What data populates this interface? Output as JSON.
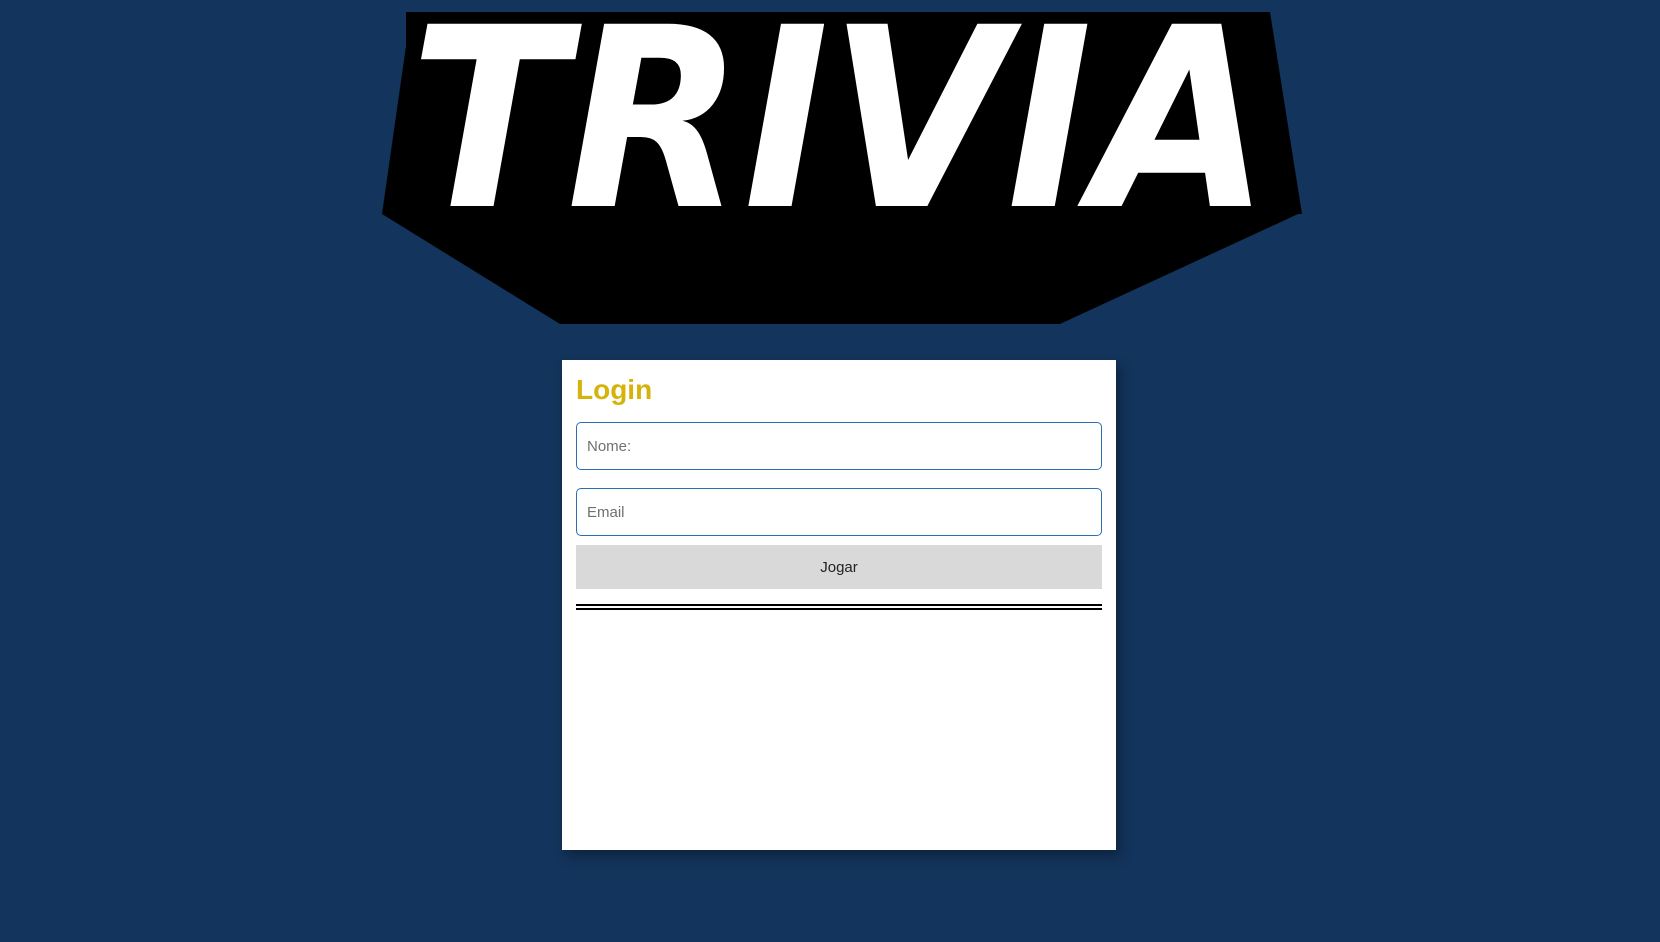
{
  "logo": {
    "text": "TRIVIA",
    "fill_color": "#ffffff",
    "shadow_color": "#000000"
  },
  "background_color": "#13345c",
  "login": {
    "title": "Login",
    "title_color": "#d6b30b",
    "name_placeholder": "Nome:",
    "name_value": "",
    "email_placeholder": "Email",
    "email_value": "",
    "play_label": "Jogar"
  }
}
